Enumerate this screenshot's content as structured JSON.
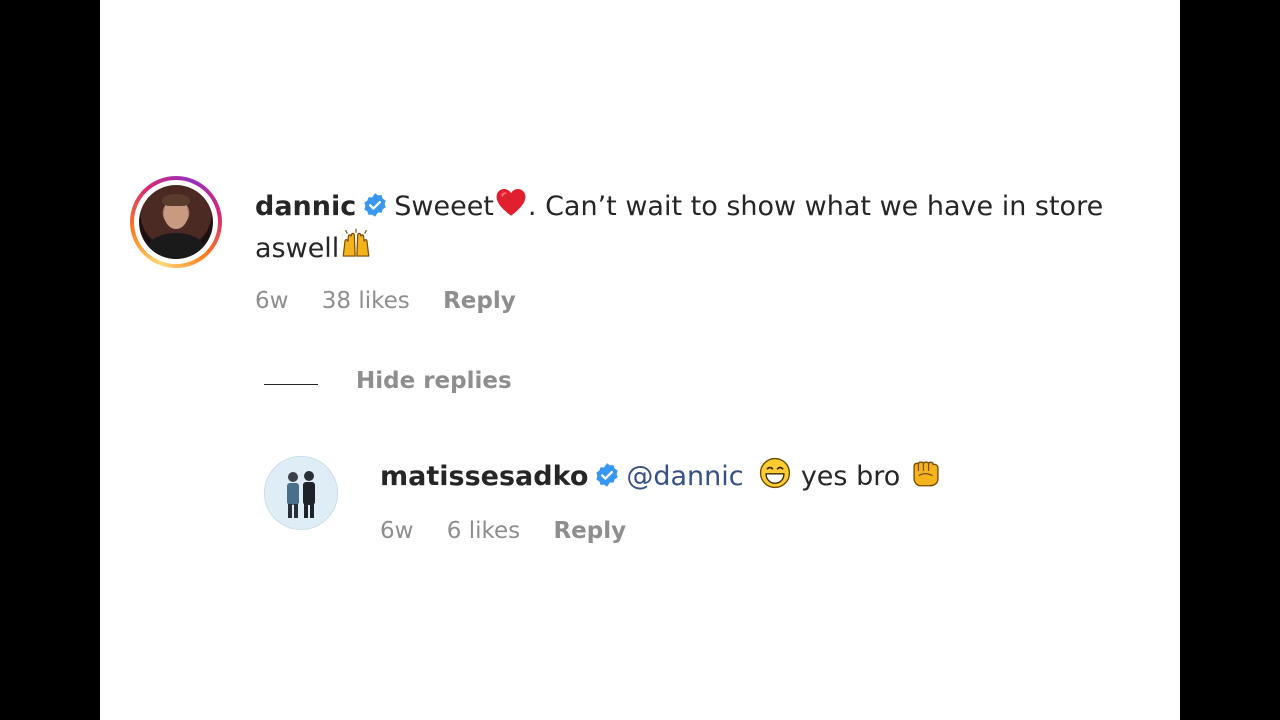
{
  "comment": {
    "username": "dannic",
    "text_part1": "Sweeet",
    "text_part2": ". Can’t wait to show what we have in store aswell",
    "time": "6w",
    "likes": "38 likes",
    "reply_label": "Reply",
    "avatar_icon": "profile-photo-man",
    "emojis": [
      "red-heart-emoji",
      "raising-hands-emoji"
    ]
  },
  "thread": {
    "hide_replies_label": "Hide replies"
  },
  "reply": {
    "username": "matissesadko",
    "mention": "@dannic",
    "text": "yes bro",
    "time": "6w",
    "likes": "6 likes",
    "reply_label": "Reply",
    "avatar_icon": "profile-photo-duo",
    "emojis": [
      "grinning-face-emoji",
      "oncoming-fist-emoji"
    ]
  },
  "colors": {
    "text": "#262626",
    "meta": "#8e8e8e",
    "verified": "#3897f0",
    "mention": "#385185",
    "background": "#ffffff",
    "letterbox": "#000000"
  }
}
